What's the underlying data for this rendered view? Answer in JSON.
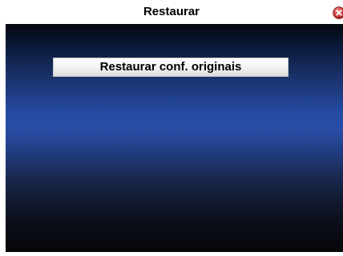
{
  "window": {
    "title": "Restaurar",
    "close_icon": "close-icon"
  },
  "main": {
    "restore_button_label": "Restaurar conf. originais"
  },
  "colors": {
    "close_icon_red": "#d23a3a",
    "background_blue": "#2449a0",
    "background_dark": "#03060d"
  }
}
